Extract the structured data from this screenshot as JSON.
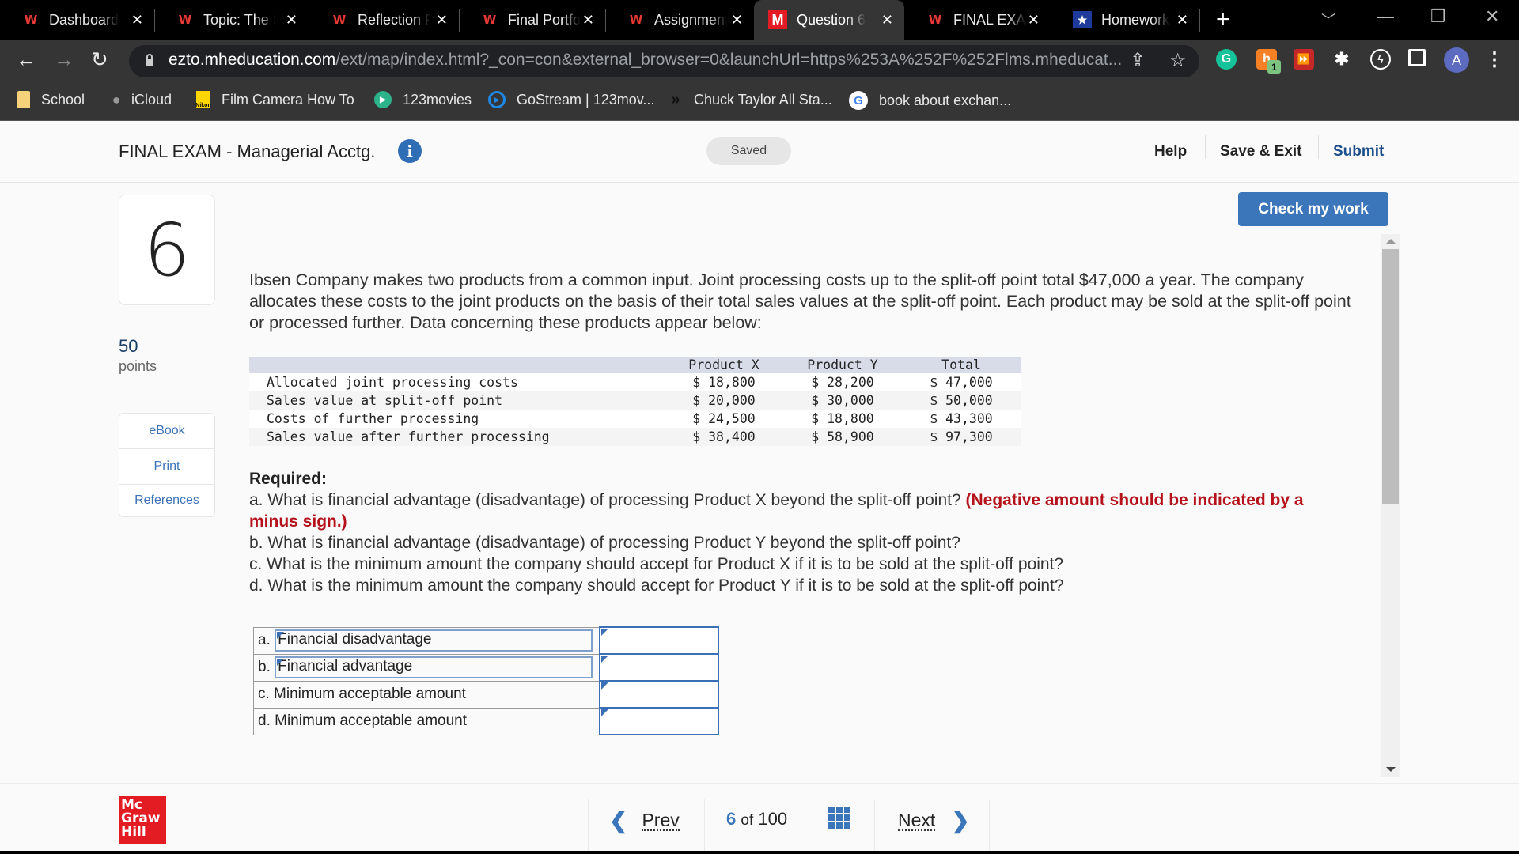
{
  "browser": {
    "tabs": [
      {
        "label": "Dashboard",
        "icon": "wheel-w-icon",
        "active": false
      },
      {
        "label": "Topic: The S",
        "icon": "wheel-w-icon",
        "active": false
      },
      {
        "label": "Reflection P",
        "icon": "wheel-w-icon",
        "active": false
      },
      {
        "label": "Final Portfol",
        "icon": "wheel-w-icon",
        "active": false
      },
      {
        "label": "Assignment",
        "icon": "wheel-w-icon",
        "active": false
      },
      {
        "label": "Question 6",
        "icon": "mcgraw-m-icon",
        "active": true
      },
      {
        "label": "FINAL EXAM",
        "icon": "wheel-w-icon",
        "active": false
      },
      {
        "label": "Homework",
        "icon": "star-badge-icon",
        "active": false
      }
    ],
    "close_glyph": "✕",
    "new_tab_glyph": "+",
    "url_domain": "ezto.mheducation.com",
    "url_path": "/ext/map/index.html?_con=con&external_browser=0&launchUrl=https%253A%252F%252Flms.mheducat...",
    "profile_initial": "A",
    "extension_badge": "1",
    "bookmarks": [
      {
        "label": "School",
        "icon": "folder-icon"
      },
      {
        "label": "iCloud",
        "icon": "apple-icon"
      },
      {
        "label": "Film Camera How To",
        "icon": "nikon-icon"
      },
      {
        "label": "123movies",
        "icon": "play-icon"
      },
      {
        "label": "GoStream | 123mov...",
        "icon": "gostream-icon"
      },
      {
        "label": "Chuck Taylor All Sta...",
        "icon": "converse-icon"
      },
      {
        "label": "book about exchan...",
        "icon": "google-icon"
      }
    ]
  },
  "header": {
    "exam_title": "FINAL EXAM - Managerial Acctg.",
    "info_glyph": "i",
    "saved_label": "Saved",
    "help_label": "Help",
    "save_exit_label": "Save & Exit",
    "submit_label": "Submit",
    "check_work_label": "Check my work"
  },
  "sidebar": {
    "question_number": "6",
    "points_value": "50",
    "points_label": "points",
    "buttons": [
      "eBook",
      "Print",
      "References"
    ]
  },
  "question": {
    "intro": "Ibsen Company makes two products from a common input. Joint processing costs up to the split-off point total $47,000 a year. The company allocates these costs to the joint products on the basis of their total sales values at the split-off point. Each product may be sold at the split-off point or processed further. Data concerning these products appear below:",
    "data_table": {
      "headers": [
        "",
        "Product X",
        "Product Y",
        "Total"
      ],
      "rows": [
        [
          "Allocated joint processing costs",
          "$ 18,800",
          "$ 28,200",
          "$ 47,000"
        ],
        [
          "Sales value at split-off point",
          "$ 20,000",
          "$ 30,000",
          "$ 50,000"
        ],
        [
          "Costs of further processing",
          "$ 24,500",
          "$ 18,800",
          "$ 43,300"
        ],
        [
          "Sales value after further processing",
          "$ 38,400",
          "$ 58,900",
          "$ 97,300"
        ]
      ]
    },
    "required_title": "Required:",
    "req_a": "a. What is financial advantage (disadvantage) of processing Product X beyond the split-off point?",
    "req_a_note": "(Negative amount should be indicated by a minus sign.)",
    "req_b": "b. What is financial advantage (disadvantage) of processing Product Y beyond the split-off point?",
    "req_c": "c. What is the minimum amount the company should accept for Product X if it is to be sold at the split-off point?",
    "req_d": "d. What is the minimum amount the company should accept for Product Y if it is to be sold at the split-off point?"
  },
  "answers": {
    "rows": [
      {
        "prefix": "a.",
        "label": "Financial disadvantage",
        "value": ""
      },
      {
        "prefix": "b.",
        "label": "Financial advantage",
        "value": ""
      },
      {
        "prefix": "",
        "label": "c. Minimum acceptable amount",
        "value": ""
      },
      {
        "prefix": "",
        "label": "d. Minimum acceptable amount",
        "value": ""
      }
    ]
  },
  "footer": {
    "logo_lines": [
      "Mc",
      "Graw",
      "Hill"
    ],
    "prev_label": "Prev",
    "next_label": "Next",
    "current_page": "6",
    "of_label": "of",
    "total_pages": "100"
  },
  "colors": {
    "accent": "#3b76bb",
    "warning_red": "#b5121b",
    "mcgraw_red": "#e31b23"
  }
}
